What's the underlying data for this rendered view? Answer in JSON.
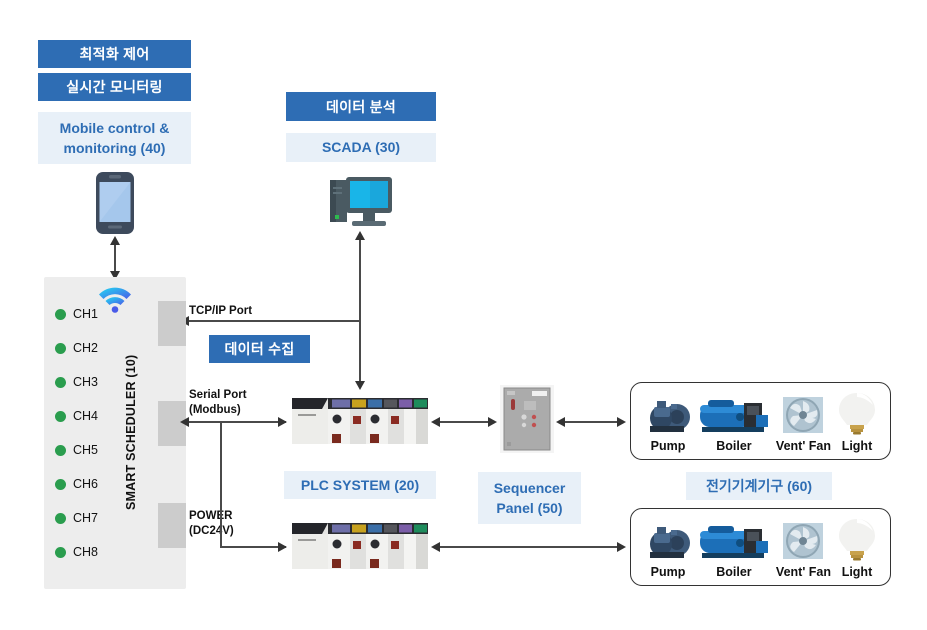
{
  "diagram": {
    "title": "Smart scheduler control system diagram"
  },
  "mobile": {
    "badge_top": "최적화 제어",
    "badge_second": "실시간 모니터링",
    "label": "Mobile control &\nmonitoring (40)",
    "device_icon": "smartphone-icon"
  },
  "scada": {
    "badge": "데이터 분석",
    "label": "SCADA (30)",
    "device_icon": "desktop-computer-icon"
  },
  "scheduler": {
    "title": "SMART SCHEDULER (10)",
    "wifi_icon": "wifi-icon",
    "channels": [
      {
        "label": "CH1",
        "status": "on"
      },
      {
        "label": "CH2",
        "status": "on"
      },
      {
        "label": "CH3",
        "status": "on"
      },
      {
        "label": "CH4",
        "status": "on"
      },
      {
        "label": "CH5",
        "status": "on"
      },
      {
        "label": "CH6",
        "status": "on"
      },
      {
        "label": "CH7",
        "status": "on"
      },
      {
        "label": "CH8",
        "status": "on"
      }
    ]
  },
  "connections": {
    "tcpip": "TCP/IP Port",
    "data_collect": "데이터 수집",
    "serial": "Serial Port\n(Modbus)",
    "power": "POWER\n(DC24V)"
  },
  "plc": {
    "label": "PLC SYSTEM (20)",
    "device_icon": "plc-rack-icon"
  },
  "sequencer": {
    "label": "Sequencer\nPanel (50)",
    "device_icon": "control-cabinet-icon"
  },
  "equipment": {
    "label": "전기기계기구 (60)",
    "items_top": [
      {
        "name": "Pump",
        "icon": "pump-icon"
      },
      {
        "name": "Boiler",
        "icon": "boiler-icon"
      },
      {
        "name": "Vent' Fan",
        "icon": "fan-icon"
      },
      {
        "name": "Light",
        "icon": "lightbulb-icon"
      }
    ],
    "items_bottom": [
      {
        "name": "Pump",
        "icon": "pump-icon"
      },
      {
        "name": "Boiler",
        "icon": "boiler-icon"
      },
      {
        "name": "Vent' Fan",
        "icon": "fan-icon"
      },
      {
        "name": "Light",
        "icon": "lightbulb-icon"
      }
    ]
  },
  "colors": {
    "badge_dark": "#2E6DB4",
    "badge_light_bg": "#E8F0F8",
    "badge_light_text": "#2E6DB4",
    "panel_bg": "#EDEDED",
    "connector_block": "#CCCCCC",
    "channel_on": "#2A9D4E",
    "arrow": "#333333"
  }
}
